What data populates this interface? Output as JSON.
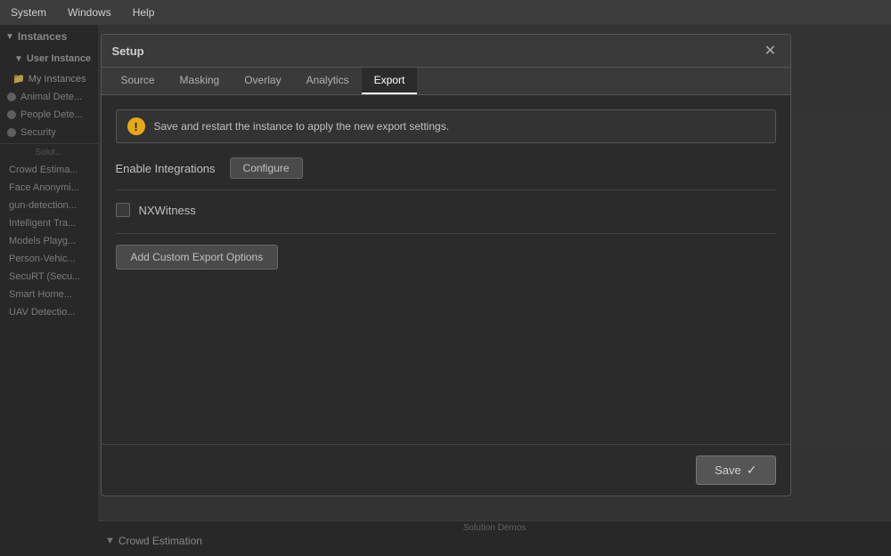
{
  "menubar": {
    "items": [
      "System",
      "Windows",
      "Help"
    ]
  },
  "sidebar": {
    "instances_label": "Instances",
    "user_instance_label": "User Instance",
    "my_instances_label": "My Instances",
    "items": [
      {
        "label": "Animal Dete...",
        "type": "dot"
      },
      {
        "label": "People Dete...",
        "type": "dot"
      },
      {
        "label": "Security",
        "type": "dot"
      }
    ],
    "solutions_label": "Solut...",
    "solution_items": [
      {
        "label": "Crowd Estima...",
        "type": "play"
      },
      {
        "label": "Face Anonymi...",
        "type": "play"
      },
      {
        "label": "gun-detection...",
        "type": "play"
      },
      {
        "label": "Intelligent Tra...",
        "type": "play"
      },
      {
        "label": "Models Playg...",
        "type": "play"
      },
      {
        "label": "Person-Vehic...",
        "type": "play"
      },
      {
        "label": "SecuRT (Secu...",
        "type": "play"
      },
      {
        "label": "Smart Home...",
        "type": "play"
      },
      {
        "label": "UAV Detectio...",
        "type": "play"
      }
    ]
  },
  "bottom": {
    "solution_demos_label": "Solution Demos",
    "crowd_estimation_label": "Crowd Estimation",
    "arrow": "▼"
  },
  "modal": {
    "title": "Setup",
    "close_label": "✕",
    "tabs": [
      {
        "label": "Source",
        "active": false
      },
      {
        "label": "Masking",
        "active": false
      },
      {
        "label": "Overlay",
        "active": false
      },
      {
        "label": "Analytics",
        "active": false
      },
      {
        "label": "Export",
        "active": true
      }
    ],
    "info_text": "Save and restart the instance to apply the new export settings.",
    "enable_integrations_label": "Enable Integrations",
    "configure_label": "Configure",
    "integration_items": [
      {
        "label": "NXWitness"
      }
    ],
    "add_custom_label": "Add Custom Export Options",
    "save_label": "Save",
    "checkmark": "✓"
  }
}
